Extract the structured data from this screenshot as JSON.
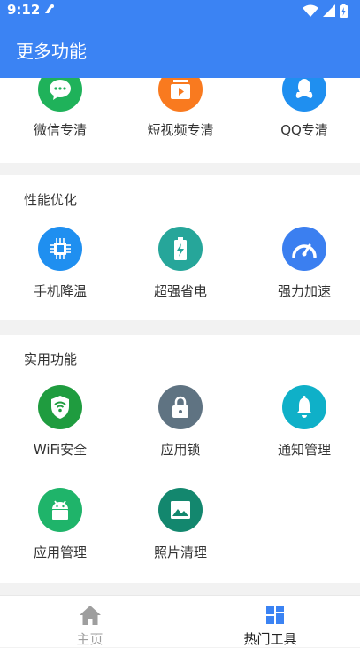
{
  "status_bar": {
    "time": "9:12"
  },
  "app_bar": {
    "title": "更多功能"
  },
  "sections": {
    "top_partial": {
      "items": [
        {
          "label": "微信专清",
          "icon": "wechat-icon",
          "color": "#1fb25a"
        },
        {
          "label": "短视频专清",
          "icon": "video-icon",
          "color": "#f97a1f"
        },
        {
          "label": "QQ专清",
          "icon": "penguin-icon",
          "color": "#1f8ff0"
        }
      ]
    },
    "performance": {
      "title": "性能优化",
      "items": [
        {
          "label": "手机降温",
          "icon": "chip-icon",
          "color": "#1f8ff0"
        },
        {
          "label": "超强省电",
          "icon": "battery-icon",
          "color": "#26a69a"
        },
        {
          "label": "强力加速",
          "icon": "speedometer-icon",
          "color": "#3b7ff0"
        }
      ]
    },
    "utilities": {
      "title": "实用功能",
      "items": [
        {
          "label": "WiFi安全",
          "icon": "wifi-shield-icon",
          "color": "#1f9c3f"
        },
        {
          "label": "应用锁",
          "icon": "lock-icon",
          "color": "#5f7382"
        },
        {
          "label": "通知管理",
          "icon": "bell-icon",
          "color": "#0fb0c8"
        },
        {
          "label": "应用管理",
          "icon": "android-icon",
          "color": "#1fb46a"
        },
        {
          "label": "照片清理",
          "icon": "photo-icon",
          "color": "#13876e"
        }
      ]
    }
  },
  "bottom_nav": {
    "home_label": "主页",
    "tools_label": "热门工具",
    "active_color": "#3b83f3",
    "inactive_color": "#9e9e9e"
  }
}
